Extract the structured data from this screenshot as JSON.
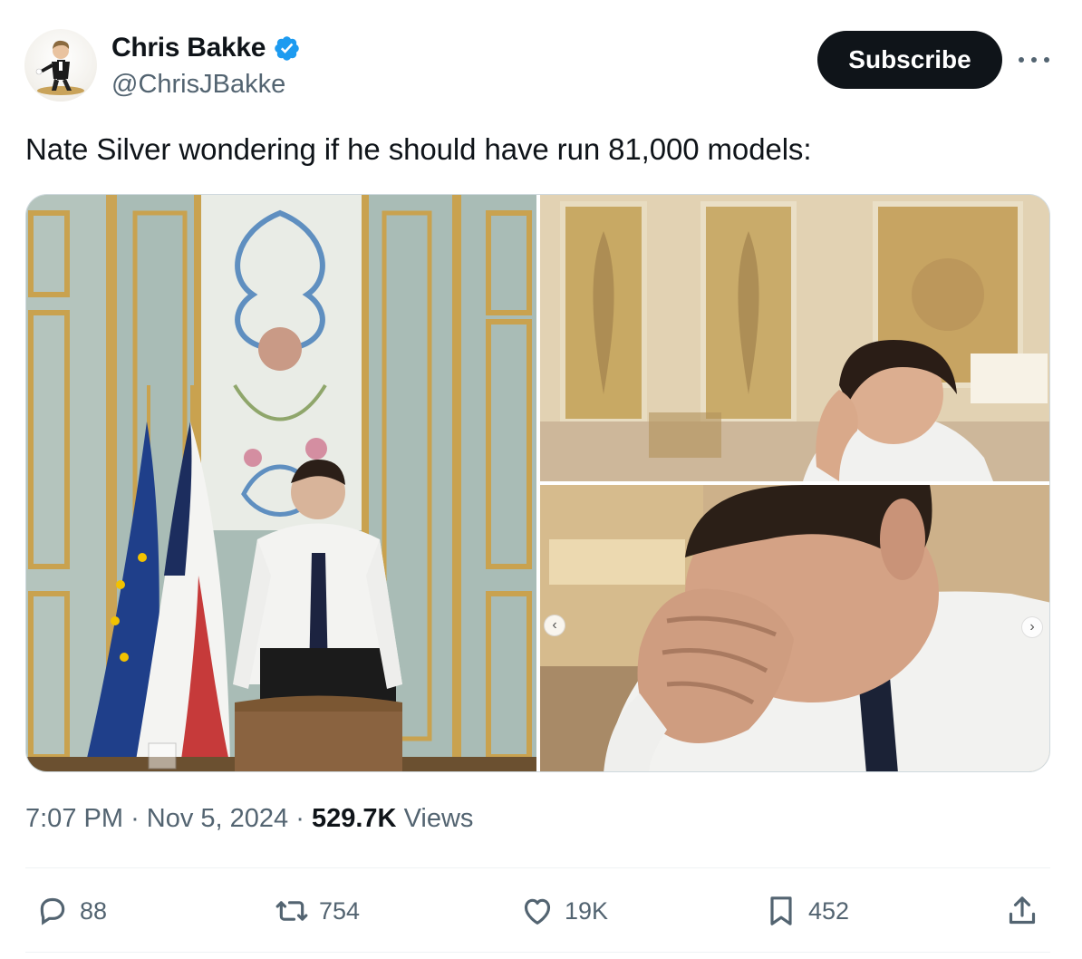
{
  "author": {
    "display_name": "Chris Bakke",
    "handle": "@ChrisJBakke",
    "verified": true,
    "verified_color": "#1d9bf0"
  },
  "subscribe_label": "Subscribe",
  "more_icon": "more-horizontal-icon",
  "tweet_text": "Nate Silver wondering if he should have run 81,000 models:",
  "media": {
    "photos": [
      {
        "name": "photo-1"
      },
      {
        "name": "photo-2"
      },
      {
        "name": "photo-3"
      }
    ],
    "prev_icon": "chevron-left-icon",
    "next_icon": "chevron-right-icon"
  },
  "meta": {
    "time": "7:07 PM",
    "date": "Nov 5, 2024",
    "views_count": "529.7K",
    "views_label": "Views",
    "separator": "·"
  },
  "actions": {
    "replies": "88",
    "reposts": "754",
    "likes": "19K",
    "bookmarks": "452"
  },
  "colors": {
    "text_primary": "#0f1419",
    "text_secondary": "#536471",
    "border": "#cfd9de"
  }
}
